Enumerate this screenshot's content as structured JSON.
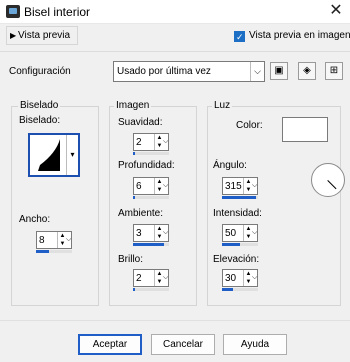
{
  "window": {
    "title": "Bisel interior",
    "close_icon": "close-icon"
  },
  "preview": {
    "toggle_label": "Vista previa",
    "checkbox_label": "Vista previa en imagen",
    "checkbox_checked": true
  },
  "config": {
    "label": "Configuración",
    "value": "Usado por última vez"
  },
  "bevel": {
    "group_label": "Biselado",
    "sub_label": "Biselado:",
    "width_label": "Ancho:",
    "width_value": "8",
    "width_fill_fraction": 0.35
  },
  "image": {
    "group_label": "Imagen",
    "smoothness_label": "Suavidad:",
    "smoothness_value": "2",
    "smoothness_fill_fraction": 0.05,
    "depth_label": "Profundidad:",
    "depth_value": "6",
    "depth_fill_fraction": 0.05,
    "ambience_label": "Ambiente:",
    "ambience_value": "3",
    "ambience_fill_fraction": 0.85,
    "shininess_label": "Brillo:",
    "shininess_value": "2",
    "shininess_fill_fraction": 0.05
  },
  "light": {
    "group_label": "Luz",
    "color_label": "Color:",
    "color_value": "#ffffff",
    "angle_label": "Ángulo:",
    "angle_value": "315",
    "angle_fill_fraction": 0.95,
    "intensity_label": "Intensidad:",
    "intensity_value": "50",
    "intensity_fill_fraction": 0.5,
    "elevation_label": "Elevación:",
    "elevation_value": "30",
    "elevation_fill_fraction": 0.3
  },
  "buttons": {
    "ok": "Aceptar",
    "cancel": "Cancelar",
    "help": "Ayuda"
  },
  "accent_color": "#1f5ec7"
}
